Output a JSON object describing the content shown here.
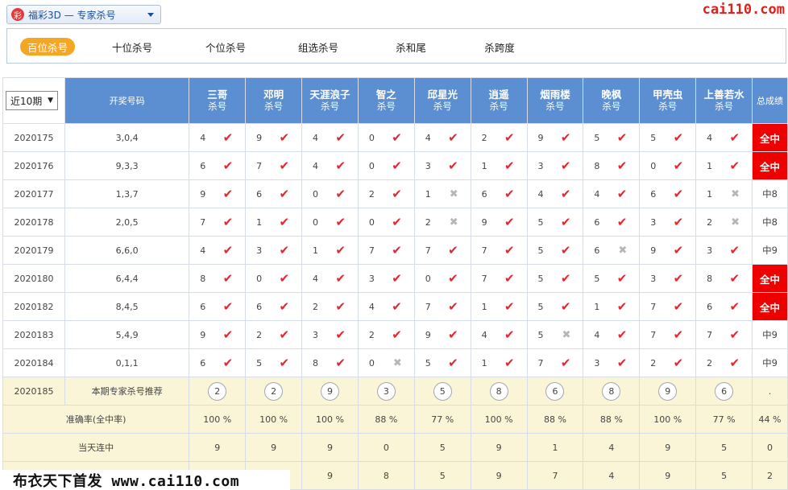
{
  "topbar": {
    "logo_glyph": "彩",
    "lottery_label": "福彩3D — 专家杀号",
    "brand": "cai110.com"
  },
  "tabs": [
    {
      "label": "百位杀号",
      "active": true
    },
    {
      "label": "十位杀号",
      "active": false
    },
    {
      "label": "个位杀号",
      "active": false
    },
    {
      "label": "组选杀号",
      "active": false
    },
    {
      "label": "杀和尾",
      "active": false
    },
    {
      "label": "杀跨度",
      "active": false
    }
  ],
  "table": {
    "period_select": "近10期",
    "draw_header": "开奖号码",
    "expert_sub": "杀号",
    "total_header": "总成绩",
    "experts": [
      "三哥",
      "邓明",
      "天涯浪子",
      "智之",
      "邱星光",
      "逍遥",
      "烟雨楼",
      "晚枫",
      "甲壳虫",
      "上善若水"
    ],
    "rows": [
      {
        "issue": "2020175",
        "draw": "3,0,4",
        "nums": [
          "4",
          "9",
          "4",
          "0",
          "4",
          "2",
          "9",
          "5",
          "5",
          "4"
        ],
        "hits": [
          1,
          1,
          1,
          1,
          1,
          1,
          1,
          1,
          1,
          1
        ],
        "total": "全中",
        "allhit": true
      },
      {
        "issue": "2020176",
        "draw": "9,3,3",
        "nums": [
          "6",
          "7",
          "4",
          "0",
          "3",
          "1",
          "3",
          "8",
          "0",
          "1"
        ],
        "hits": [
          1,
          1,
          1,
          1,
          1,
          1,
          1,
          1,
          1,
          1
        ],
        "total": "全中",
        "allhit": true
      },
      {
        "issue": "2020177",
        "draw": "1,3,7",
        "nums": [
          "9",
          "6",
          "0",
          "2",
          "1",
          "6",
          "4",
          "4",
          "6",
          "1"
        ],
        "hits": [
          1,
          1,
          1,
          1,
          0,
          1,
          1,
          1,
          1,
          0
        ],
        "total": "中8",
        "allhit": false
      },
      {
        "issue": "2020178",
        "draw": "2,0,5",
        "nums": [
          "7",
          "1",
          "0",
          "0",
          "2",
          "9",
          "5",
          "6",
          "3",
          "2"
        ],
        "hits": [
          1,
          1,
          1,
          1,
          0,
          1,
          1,
          1,
          1,
          0
        ],
        "total": "中8",
        "allhit": false
      },
      {
        "issue": "2020179",
        "draw": "6,6,0",
        "nums": [
          "4",
          "3",
          "1",
          "7",
          "7",
          "7",
          "5",
          "6",
          "9",
          "3"
        ],
        "hits": [
          1,
          1,
          1,
          1,
          1,
          1,
          1,
          0,
          1,
          1
        ],
        "total": "中9",
        "allhit": false
      },
      {
        "issue": "2020180",
        "draw": "6,4,4",
        "nums": [
          "8",
          "0",
          "4",
          "3",
          "0",
          "7",
          "5",
          "5",
          "3",
          "8"
        ],
        "hits": [
          1,
          1,
          1,
          1,
          1,
          1,
          1,
          1,
          1,
          1
        ],
        "total": "全中",
        "allhit": true
      },
      {
        "issue": "2020182",
        "draw": "8,4,5",
        "nums": [
          "6",
          "6",
          "2",
          "4",
          "7",
          "1",
          "5",
          "1",
          "7",
          "6"
        ],
        "hits": [
          1,
          1,
          1,
          1,
          1,
          1,
          1,
          1,
          1,
          1
        ],
        "total": "全中",
        "allhit": true
      },
      {
        "issue": "2020183",
        "draw": "5,4,9",
        "nums": [
          "9",
          "2",
          "3",
          "2",
          "9",
          "4",
          "5",
          "4",
          "7",
          "7"
        ],
        "hits": [
          1,
          1,
          1,
          1,
          1,
          1,
          0,
          1,
          1,
          1
        ],
        "total": "中9",
        "allhit": false
      },
      {
        "issue": "2020184",
        "draw": "0,1,1",
        "nums": [
          "6",
          "5",
          "8",
          "0",
          "5",
          "1",
          "7",
          "3",
          "2",
          "2"
        ],
        "hits": [
          1,
          1,
          1,
          0,
          1,
          1,
          1,
          1,
          1,
          1
        ],
        "total": "中9",
        "allhit": false
      }
    ],
    "recommend": {
      "issue": "2020185",
      "label": "本期专家杀号推荐",
      "nums": [
        "2",
        "2",
        "9",
        "3",
        "5",
        "8",
        "6",
        "8",
        "9",
        "6"
      ],
      "total": "."
    },
    "accuracy": {
      "label": "准确率(全中率)",
      "values": [
        "100 %",
        "100 %",
        "100 %",
        "88 %",
        "77 %",
        "100 %",
        "88 %",
        "88 %",
        "100 %",
        "77 %"
      ],
      "total": "44 %"
    },
    "streak": {
      "label": "当天连中",
      "values": [
        "9",
        "9",
        "9",
        "0",
        "5",
        "9",
        "1",
        "4",
        "9",
        "5"
      ],
      "total": "0"
    },
    "lastrow": {
      "label": "",
      "values": [
        "",
        "",
        "9",
        "8",
        "5",
        "9",
        "7",
        "4",
        "9",
        "5"
      ],
      "total": "2"
    }
  },
  "watermark": "布衣天下首发 www.cai110.com"
}
